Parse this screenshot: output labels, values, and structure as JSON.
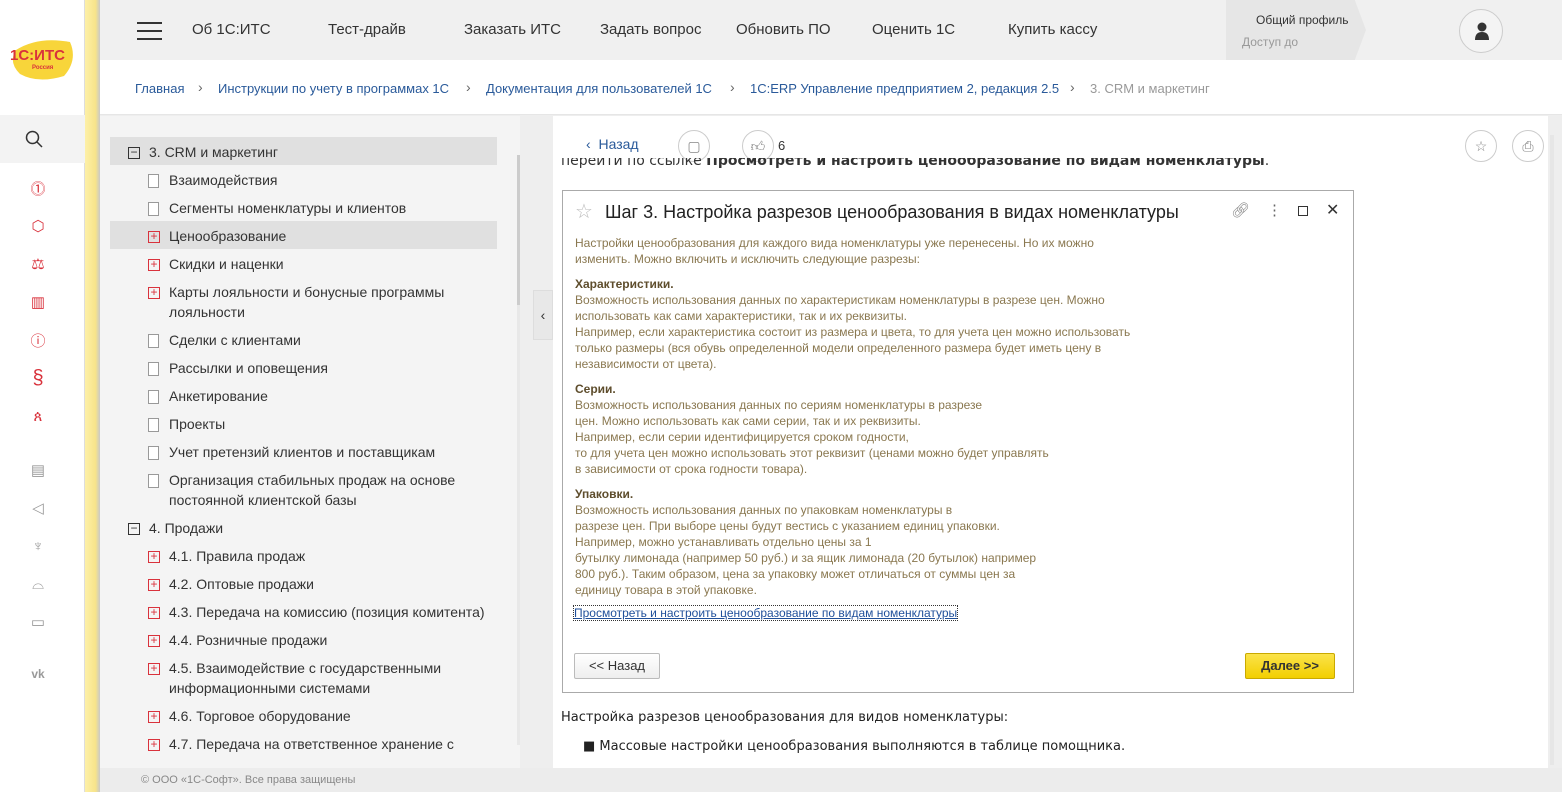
{
  "logo": {
    "text": "1С:ИТС",
    "sub": "Россия"
  },
  "rail": {
    "icons": [
      "search-icon",
      "1c-icon",
      "cube-icon",
      "scales-icon",
      "books-icon",
      "info-icon",
      "paragraph-icon",
      "people-icon",
      "newspaper-icon",
      "megaphone-icon",
      "trophy-icon",
      "graduation-cap-icon",
      "chat-icon",
      "vk-icon"
    ]
  },
  "nav": [
    "Об 1С:ИТС",
    "Тест-драйв",
    "Заказать ИТС",
    "Задать вопрос",
    "Обновить ПО",
    "Оценить 1С",
    "Купить кассу"
  ],
  "profile": {
    "title": "Общий профиль",
    "access": "Доступ до"
  },
  "breadcrumbs": [
    "Главная",
    "Инструкции по учету в программах 1С",
    "Документация для пользователей 1С",
    "1С:ERP Управление предприятием 2, редакция 2.5",
    "3. CRM и маркетинг"
  ],
  "tree": [
    {
      "label": "3. CRM и маркетинг",
      "type": "minus"
    },
    {
      "label": "Взаимодействия",
      "type": "doc"
    },
    {
      "label": "Сегменты номенклатуры и клиентов",
      "type": "doc"
    },
    {
      "label": "Ценообразование",
      "type": "plus"
    },
    {
      "label": "Скидки и наценки",
      "type": "plus"
    },
    {
      "label": "Карты лояльности и бонусные программы\nлояльности",
      "type": "plus"
    },
    {
      "label": "Сделки с клиентами",
      "type": "doc"
    },
    {
      "label": "Рассылки и оповещения",
      "type": "doc"
    },
    {
      "label": "Анкетирование",
      "type": "doc"
    },
    {
      "label": "Проекты",
      "type": "doc"
    },
    {
      "label": "Учет претензий клиентов и поставщикам",
      "type": "doc"
    },
    {
      "label": "Организация стабильных продаж на основе\nпостоянной клиентской базы",
      "type": "doc"
    },
    {
      "label": "4. Продажи",
      "type": "minus"
    },
    {
      "label": "4.1. Правила продаж",
      "type": "plus"
    },
    {
      "label": "4.2. Оптовые продажи",
      "type": "plus"
    },
    {
      "label": "4.3. Передача на комиссию (позиция комитента)",
      "type": "plus"
    },
    {
      "label": "4.4. Розничные продажи",
      "type": "plus"
    },
    {
      "label": "4.5. Взаимодействие с государственными\nинформационными системами",
      "type": "plus"
    },
    {
      "label": "4.6. Торговое оборудование",
      "type": "plus"
    },
    {
      "label": "4.7. Передача на ответственное хранение с",
      "type": "plus"
    }
  ],
  "toolbar": {
    "back": "Назад",
    "likes": "6"
  },
  "content": {
    "intro_prefix": "перейти по ссылке ",
    "intro_bold": "Просмотреть и настроить ценообразование по видам номенклатуры",
    "intro_suffix": ".",
    "after": "Настройка разрезов ценообразования для видов номенклатуры:",
    "bullet": "Массовые настройки ценообразования выполняются в таблице помощника."
  },
  "dialog": {
    "title": "Шаг 3. Настройка разрезов ценообразования в видах номенклатуры",
    "intro": "Настройки ценообразования для каждого вида номенклатуры уже перенесены. Но их можно\nизменить. Можно включить и исключить следующие разрезы:",
    "sections": [
      {
        "title": "Характеристики.",
        "text": "Возможность использования данных по характеристикам номенклатуры в разрезе  цен. Можно\nиспользовать как сами характеристики, так и их реквизиты.\nНапример, если характеристика состоит из размера и цвета, то для учета цен можно использовать\nтолько размеры (вся обувь определенной модели определенного размера будет иметь цену в\nнезависимости от цвета)."
      },
      {
        "title": "Серии.",
        "text": "Возможность использования данных по сериям номенклатуры в разрезе\nцен. Можно использовать как сами серии, так и их реквизиты.\nНапример, если серии идентифицируется сроком годности,\nто для учета цен можно использовать этот реквизит (ценами можно будет управлять\nв зависимости от срока годности товара)."
      },
      {
        "title": "Упаковки.",
        "text": "Возможность использования данных по упаковкам номенклатуры в\nразрезе цен. При выборе цены будут вестись с указанием единиц упаковки.\nНапример, можно устанавливать отдельно цены за 1\nбутылку лимонада (например 50 руб.) и за ящик лимонада (20 бутылок) например\n800 руб.). Таким образом, цена за упаковку может отличаться от суммы цен за\nединицу товара в этой упаковке."
      }
    ],
    "link": "Просмотреть и настроить ценообразование по видам номенклатуры",
    "back_button": "<< Назад",
    "next_button": "Далее >>"
  },
  "footer": "© ООО «1С-Софт». Все права защищены",
  "colors": {
    "accent_red": "#d9323c",
    "link": "#2a5a9a",
    "yellow_button": "#f5d800"
  }
}
